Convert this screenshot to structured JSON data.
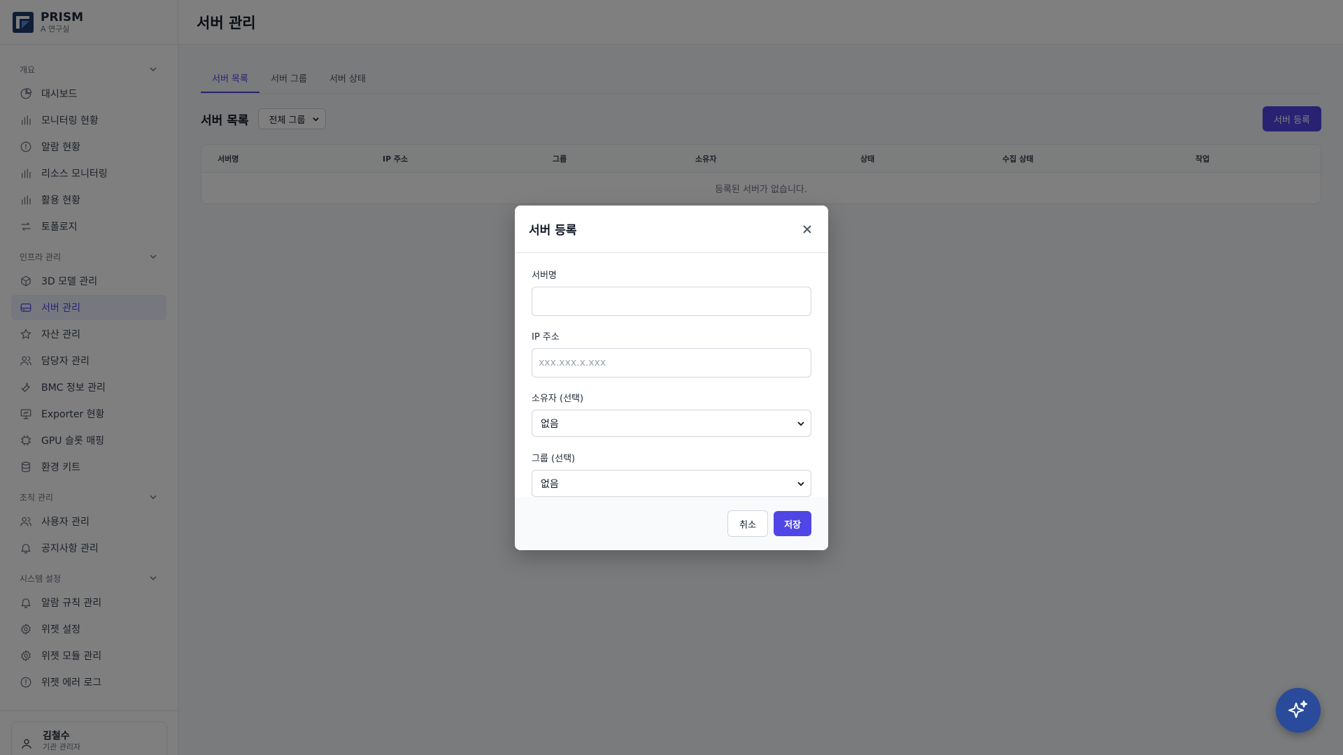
{
  "brand": {
    "name": "PRISM",
    "sub": "A 연구실"
  },
  "sidebar": {
    "sections": [
      {
        "title": "개요",
        "items": [
          {
            "label": "대시보드",
            "icon": "pie-chart-icon"
          },
          {
            "label": "모니터링 현황",
            "icon": "bar-chart-icon"
          },
          {
            "label": "알람 현황",
            "icon": "alert-circle-icon"
          },
          {
            "label": "리소스 모니터링",
            "icon": "bar-chart-icon"
          },
          {
            "label": "활용 현황",
            "icon": "bar-chart-icon"
          },
          {
            "label": "토폴로지",
            "icon": "arrows-swap-icon"
          }
        ]
      },
      {
        "title": "인프라 관리",
        "items": [
          {
            "label": "3D 모델 관리",
            "icon": "cube-icon"
          },
          {
            "label": "서버 관리",
            "icon": "server-icon",
            "active": true
          },
          {
            "label": "자산 관리",
            "icon": "star-icon"
          },
          {
            "label": "담당자 관리",
            "icon": "users-icon"
          },
          {
            "label": "BMC 정보 관리",
            "icon": "wrench-icon"
          },
          {
            "label": "Exporter 현황",
            "icon": "presentation-icon"
          },
          {
            "label": "GPU 슬롯 매핑",
            "icon": "chip-icon"
          },
          {
            "label": "환경 키트",
            "icon": "database-icon"
          }
        ]
      },
      {
        "title": "조직 관리",
        "items": [
          {
            "label": "사용자 관리",
            "icon": "users-icon"
          },
          {
            "label": "공지사항 관리",
            "icon": "bell-icon"
          }
        ]
      },
      {
        "title": "시스템 설정",
        "items": [
          {
            "label": "알람 규칙 관리",
            "icon": "bell-icon"
          },
          {
            "label": "위젯 설정",
            "icon": "gear-icon"
          },
          {
            "label": "위젯 모듈 관리",
            "icon": "gear-icon"
          },
          {
            "label": "위젯 에러 로그",
            "icon": "alert-circle-icon"
          }
        ]
      }
    ]
  },
  "user": {
    "name": "김철수",
    "role": "기관 관리자"
  },
  "header": {
    "title": "서버 관리"
  },
  "tabs": [
    "서버 목록",
    "서버 그룹",
    "서버 상태"
  ],
  "toolbar": {
    "list_title": "서버 목록",
    "group_filter": "전체 그룹",
    "add_button": "서버 등록"
  },
  "table": {
    "columns": [
      "서버명",
      "IP 주소",
      "그룹",
      "소유자",
      "상태",
      "수집 상태",
      "작업"
    ],
    "empty_text": "등록된 서버가 없습니다."
  },
  "modal": {
    "title": "서버 등록",
    "fields": {
      "server_name": {
        "label": "서버명",
        "value": "",
        "placeholder": ""
      },
      "ip": {
        "label": "IP 주소",
        "value": "",
        "placeholder": "xxx.xxx.x.xxx"
      },
      "owner": {
        "label": "소유자 (선택)",
        "value": "없음"
      },
      "group": {
        "label": "그룹 (선택)",
        "value": "없음"
      }
    },
    "cancel_label": "취소",
    "save_label": "저장"
  },
  "colors": {
    "accent": "#4f46e5",
    "fab": "#2a4b9b"
  }
}
